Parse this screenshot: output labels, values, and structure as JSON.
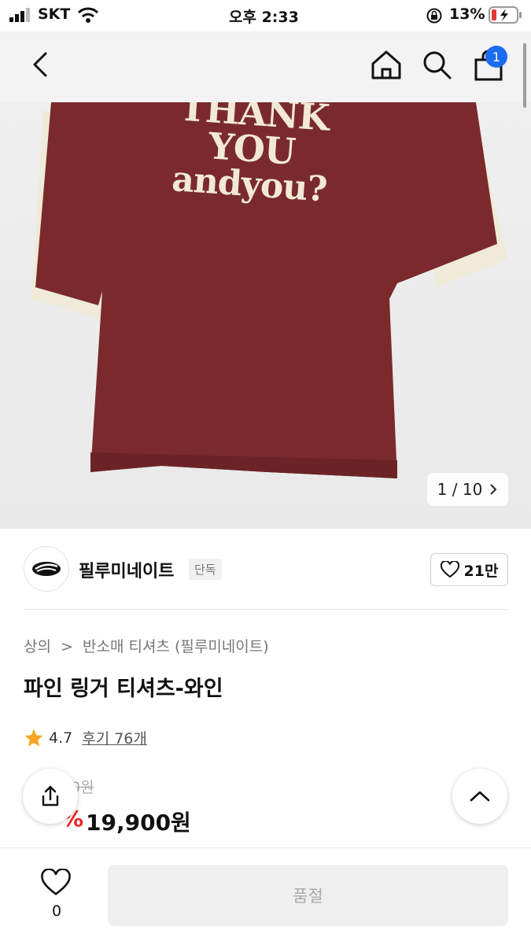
{
  "status_bar": {
    "carrier": "SKT",
    "time": "오후 2:33",
    "battery_percent": "13%",
    "icons": [
      "signal-icon",
      "wifi-icon",
      "orientation-lock-icon",
      "battery-low-icon"
    ]
  },
  "header": {
    "icons": [
      "back-icon",
      "home-icon",
      "search-icon",
      "cart-icon"
    ],
    "cart_badge_count": "1"
  },
  "product_image": {
    "counter_text": "1 / 10",
    "print_lines": [
      "THANK YOU",
      "andyou?"
    ],
    "colors": {
      "shirt": "#7a2a2c",
      "trim": "#f0ead8",
      "print": "#f2e8d6"
    }
  },
  "brand": {
    "name": "필루미네이트",
    "badge": "단독",
    "like_count": "21만"
  },
  "breadcrumb": {
    "category": "상의",
    "separator": ">",
    "subcategory": "반소매 티셔츠 (필루미네이트)"
  },
  "product": {
    "title": "파인 링거 티셔츠-와인",
    "rating": "4.7",
    "reviews_label": "후기 76개",
    "original_price_visible": "0원",
    "discount_rate_visible": "%",
    "sale_price": "19,900원"
  },
  "bottom_bar": {
    "wish_count": "0",
    "soldout_label": "품절"
  },
  "colors": {
    "accent_red": "#ee2222",
    "star": "#f6a623",
    "badge_blue": "#1a6cf0"
  }
}
